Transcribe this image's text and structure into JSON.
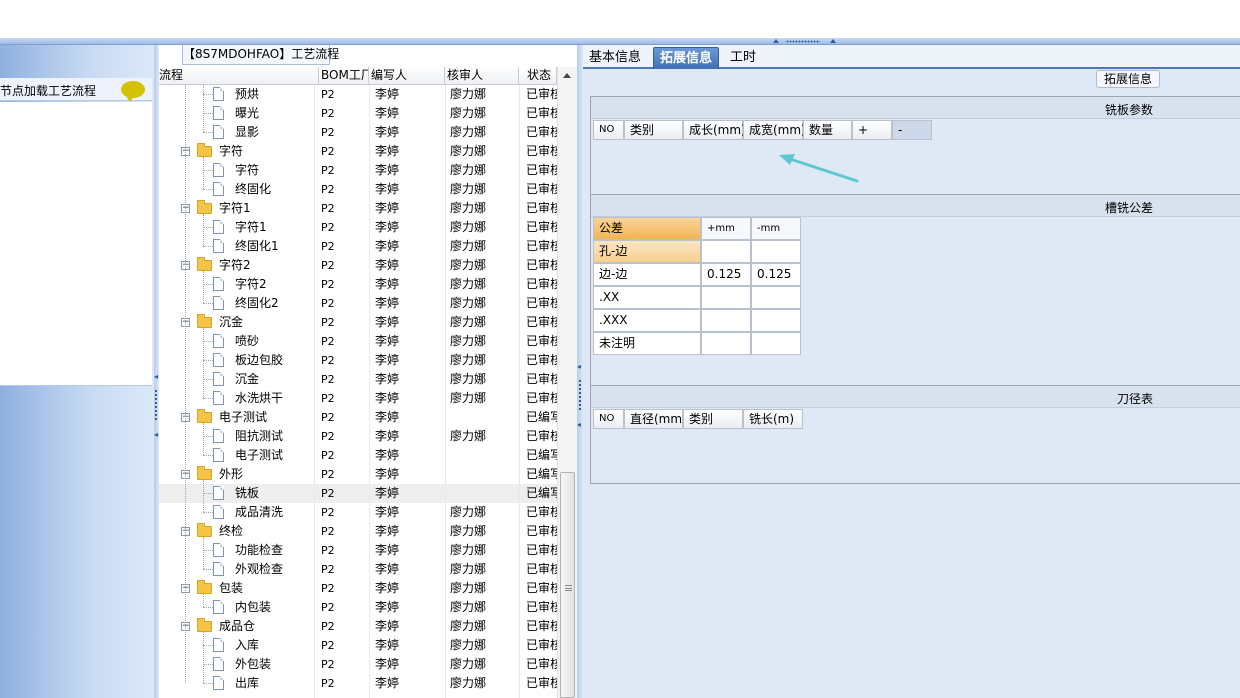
{
  "left": {
    "header_text": "节点加载工艺流程"
  },
  "tree": {
    "title": "【8S7MDOHFAO】工艺流程",
    "columns": [
      "流程",
      "BOM工厂",
      "编写人",
      "核审人",
      "状态"
    ],
    "rows": [
      {
        "name": "预烘",
        "bom": "P2",
        "author": "李婷",
        "reviewer": "廖力娜",
        "status": "已审核",
        "kind": "doc"
      },
      {
        "name": "曝光",
        "bom": "P2",
        "author": "李婷",
        "reviewer": "廖力娜",
        "status": "已审核",
        "kind": "doc"
      },
      {
        "name": "显影",
        "bom": "P2",
        "author": "李婷",
        "reviewer": "廖力娜",
        "status": "已审核",
        "kind": "doc"
      },
      {
        "name": "字符",
        "bom": "P2",
        "author": "李婷",
        "reviewer": "廖力娜",
        "status": "已审核",
        "kind": "folder"
      },
      {
        "name": "字符",
        "bom": "P2",
        "author": "李婷",
        "reviewer": "廖力娜",
        "status": "已审核",
        "kind": "doc"
      },
      {
        "name": "终固化",
        "bom": "P2",
        "author": "李婷",
        "reviewer": "廖力娜",
        "status": "已审核",
        "kind": "doc"
      },
      {
        "name": "字符1",
        "bom": "P2",
        "author": "李婷",
        "reviewer": "廖力娜",
        "status": "已审核",
        "kind": "folder"
      },
      {
        "name": "字符1",
        "bom": "P2",
        "author": "李婷",
        "reviewer": "廖力娜",
        "status": "已审核",
        "kind": "doc"
      },
      {
        "name": "终固化1",
        "bom": "P2",
        "author": "李婷",
        "reviewer": "廖力娜",
        "status": "已审核",
        "kind": "doc"
      },
      {
        "name": "字符2",
        "bom": "P2",
        "author": "李婷",
        "reviewer": "廖力娜",
        "status": "已审核",
        "kind": "folder"
      },
      {
        "name": "字符2",
        "bom": "P2",
        "author": "李婷",
        "reviewer": "廖力娜",
        "status": "已审核",
        "kind": "doc"
      },
      {
        "name": "终固化2",
        "bom": "P2",
        "author": "李婷",
        "reviewer": "廖力娜",
        "status": "已审核",
        "kind": "doc"
      },
      {
        "name": "沉金",
        "bom": "P2",
        "author": "李婷",
        "reviewer": "廖力娜",
        "status": "已审核",
        "kind": "folder"
      },
      {
        "name": "喷砂",
        "bom": "P2",
        "author": "李婷",
        "reviewer": "廖力娜",
        "status": "已审核",
        "kind": "doc"
      },
      {
        "name": "板边包胶",
        "bom": "P2",
        "author": "李婷",
        "reviewer": "廖力娜",
        "status": "已审核",
        "kind": "doc"
      },
      {
        "name": "沉金",
        "bom": "P2",
        "author": "李婷",
        "reviewer": "廖力娜",
        "status": "已审核",
        "kind": "doc"
      },
      {
        "name": "水洗烘干",
        "bom": "P2",
        "author": "李婷",
        "reviewer": "廖力娜",
        "status": "已审核",
        "kind": "doc"
      },
      {
        "name": "电子测试",
        "bom": "P2",
        "author": "李婷",
        "reviewer": "",
        "status": "已编写",
        "kind": "folder"
      },
      {
        "name": "阻抗测试",
        "bom": "P2",
        "author": "李婷",
        "reviewer": "廖力娜",
        "status": "已审核",
        "kind": "doc"
      },
      {
        "name": "电子测试",
        "bom": "P2",
        "author": "李婷",
        "reviewer": "",
        "status": "已编写",
        "kind": "doc"
      },
      {
        "name": "外形",
        "bom": "P2",
        "author": "李婷",
        "reviewer": "",
        "status": "已编写",
        "kind": "folder"
      },
      {
        "name": "铣板",
        "bom": "P2",
        "author": "李婷",
        "reviewer": "",
        "status": "已编写",
        "kind": "doc",
        "selected": true
      },
      {
        "name": "成品清洗",
        "bom": "P2",
        "author": "李婷",
        "reviewer": "廖力娜",
        "status": "已审核",
        "kind": "doc"
      },
      {
        "name": "终检",
        "bom": "P2",
        "author": "李婷",
        "reviewer": "廖力娜",
        "status": "已审核",
        "kind": "folder"
      },
      {
        "name": "功能检查",
        "bom": "P2",
        "author": "李婷",
        "reviewer": "廖力娜",
        "status": "已审核",
        "kind": "doc"
      },
      {
        "name": "外观检查",
        "bom": "P2",
        "author": "李婷",
        "reviewer": "廖力娜",
        "status": "已审核",
        "kind": "doc"
      },
      {
        "name": "包装",
        "bom": "P2",
        "author": "李婷",
        "reviewer": "廖力娜",
        "status": "已审核",
        "kind": "folder"
      },
      {
        "name": "内包装",
        "bom": "P2",
        "author": "李婷",
        "reviewer": "廖力娜",
        "status": "已审核",
        "kind": "doc"
      },
      {
        "name": "成品仓",
        "bom": "P2",
        "author": "李婷",
        "reviewer": "廖力娜",
        "status": "已审核",
        "kind": "folder"
      },
      {
        "name": "入库",
        "bom": "P2",
        "author": "李婷",
        "reviewer": "廖力娜",
        "status": "已审核",
        "kind": "doc"
      },
      {
        "name": "外包装",
        "bom": "P2",
        "author": "李婷",
        "reviewer": "廖力娜",
        "status": "已审核",
        "kind": "doc"
      },
      {
        "name": "出库",
        "bom": "P2",
        "author": "李婷",
        "reviewer": "廖力娜",
        "status": "已审核",
        "kind": "doc"
      }
    ]
  },
  "right": {
    "tabs": [
      "基本信息",
      "拓展信息",
      "工时"
    ],
    "active_tab": "拓展信息",
    "ext_label": "拓展信息",
    "mill_params": {
      "title": "铣板参数",
      "headers": [
        "NO",
        "类别",
        "成长(mm)",
        "成宽(mm)",
        "数量",
        "+",
        "-"
      ]
    },
    "tolerance": {
      "title": "槽铣公差",
      "headers": [
        "公差",
        "+mm",
        "-mm"
      ],
      "rows": [
        {
          "label": "孔-边",
          "plus": "",
          "minus": ""
        },
        {
          "label": "边-边",
          "plus": "0.125",
          "minus": "0.125"
        },
        {
          "label": ".XX",
          "plus": "",
          "minus": ""
        },
        {
          "label": ".XXX",
          "plus": "",
          "minus": ""
        },
        {
          "label": "未注明",
          "plus": "",
          "minus": ""
        }
      ]
    },
    "tool_table": {
      "title": "刀径表",
      "headers": [
        "NO",
        "直径(mm)",
        "类别",
        "铣长(m)"
      ]
    }
  },
  "colors": {
    "tab_active": "#4a78b8",
    "tolerance_header": "#f3b453",
    "annotation_arrow": "#5ec8d0"
  }
}
